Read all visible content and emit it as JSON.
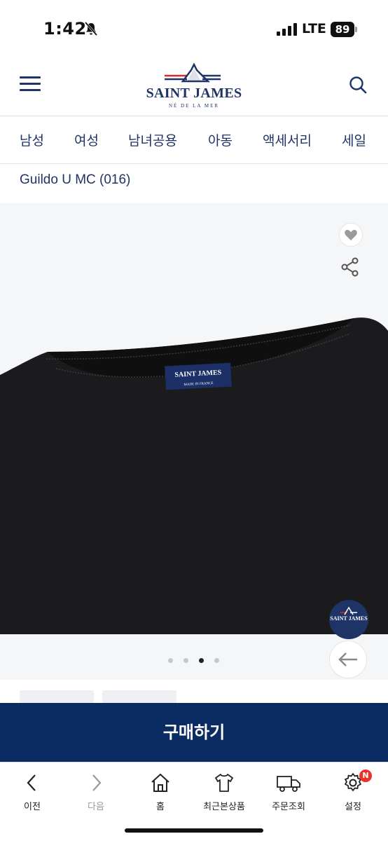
{
  "status_bar": {
    "time": "1:42",
    "network": "LTE",
    "battery": "89"
  },
  "header": {
    "brand_name": "SAINT JAMES",
    "brand_tagline": "NÉ DE LA MER"
  },
  "category_nav": [
    "남성",
    "여성",
    "남녀공용",
    "아동",
    "액세서리",
    "세일"
  ],
  "product": {
    "title": "Guildo U MC (016)",
    "label_brand": "SAINT JAMES",
    "label_origin": "MADE IN FRANCE"
  },
  "gallery": {
    "slide_count": 4,
    "active_slide": 3,
    "badge_text": "SAINT JAMES"
  },
  "buy_button": {
    "label": "구매하기"
  },
  "bottom_nav": {
    "prev": "이전",
    "next": "다음",
    "home": "홈",
    "recent": "최근본상품",
    "orders": "주문조회",
    "settings": "설정",
    "settings_badge": "N"
  },
  "colors": {
    "navy": "#1f3466",
    "buy_bg": "#0b2c63",
    "badge_red": "#e8322b"
  },
  "icons": [
    "mute-icon",
    "signal-icon",
    "menu-icon",
    "search-icon",
    "heart-icon",
    "share-icon",
    "arrow-left-icon",
    "chevron-left-icon",
    "chevron-right-icon",
    "home-icon",
    "tshirt-icon",
    "truck-icon",
    "gear-icon"
  ]
}
